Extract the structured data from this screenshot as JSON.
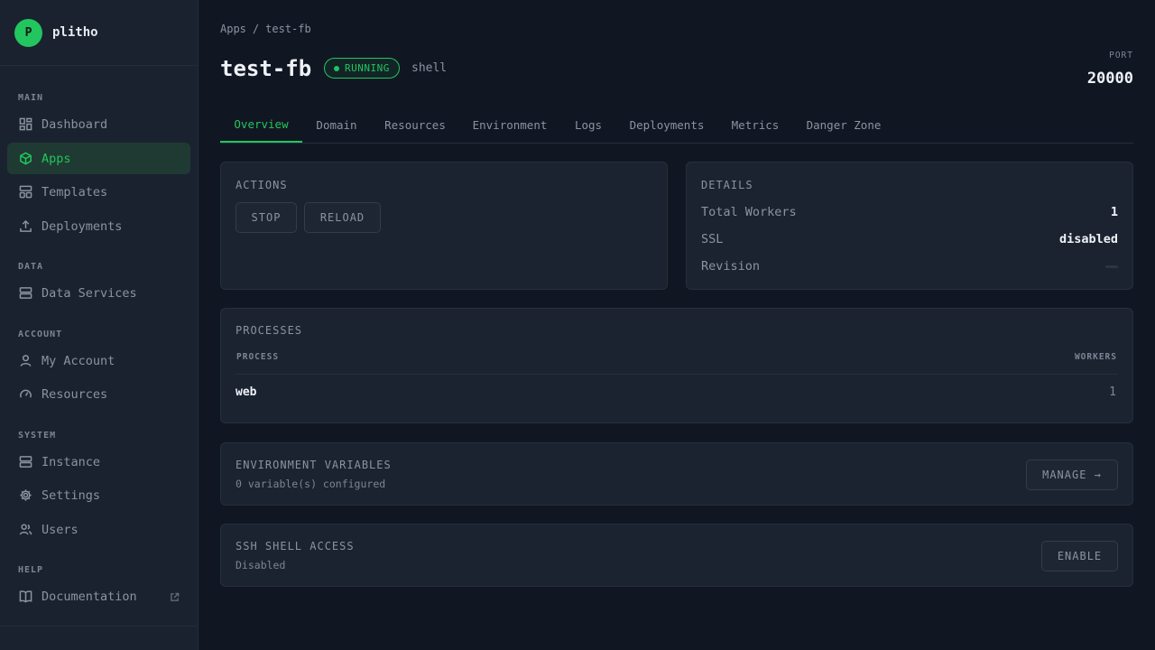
{
  "brand": {
    "logo_letter": "P",
    "name": "plitho"
  },
  "sidebar": {
    "sections": [
      {
        "label": "MAIN"
      },
      {
        "label": "DATA"
      },
      {
        "label": "ACCOUNT"
      },
      {
        "label": "SYSTEM"
      },
      {
        "label": "HELP"
      }
    ],
    "items": [
      {
        "label": "Dashboard",
        "icon": "dashboard-icon"
      },
      {
        "label": "Apps",
        "icon": "box-icon",
        "active": true
      },
      {
        "label": "Templates",
        "icon": "templates-icon"
      },
      {
        "label": "Deployments",
        "icon": "upload-icon"
      },
      {
        "label": "Data Services",
        "icon": "server-icon"
      },
      {
        "label": "My Account",
        "icon": "user-icon"
      },
      {
        "label": "Resources",
        "icon": "gauge-icon"
      },
      {
        "label": "Instance",
        "icon": "server-icon"
      },
      {
        "label": "Settings",
        "icon": "gear-icon"
      },
      {
        "label": "Users",
        "icon": "users-icon"
      },
      {
        "label": "Documentation",
        "icon": "book-icon",
        "external": true
      }
    ]
  },
  "breadcrumb": {
    "root": "Apps",
    "separator": "/",
    "current": "test-fb"
  },
  "header": {
    "title": "test-fb",
    "status": "RUNNING",
    "type": "shell",
    "port_label": "PORT",
    "port_value": "20000"
  },
  "tabs": [
    {
      "label": "Overview",
      "active": true
    },
    {
      "label": "Domain"
    },
    {
      "label": "Resources"
    },
    {
      "label": "Environment"
    },
    {
      "label": "Logs"
    },
    {
      "label": "Deployments"
    },
    {
      "label": "Metrics"
    },
    {
      "label": "Danger Zone"
    }
  ],
  "actions": {
    "title": "ACTIONS",
    "stop_label": "STOP",
    "reload_label": "RELOAD"
  },
  "details": {
    "title": "DETAILS",
    "rows": [
      {
        "label": "Total Workers",
        "value": "1"
      },
      {
        "label": "SSL",
        "value": "disabled"
      },
      {
        "label": "Revision",
        "value": ""
      }
    ]
  },
  "processes": {
    "title": "PROCESSES",
    "columns": [
      "PROCESS",
      "WORKERS"
    ],
    "rows": [
      {
        "name": "web",
        "workers": "1"
      }
    ]
  },
  "env_vars": {
    "title": "ENVIRONMENT VARIABLES",
    "subtitle": "0 variable(s) configured",
    "button_label": "MANAGE →"
  },
  "ssh": {
    "title": "SSH SHELL ACCESS",
    "subtitle": "Disabled",
    "button_label": "ENABLE"
  },
  "colors": {
    "accent": "#22c55e",
    "background": "#111722",
    "sidebar": "#1a2230",
    "card": "#1b2331"
  }
}
